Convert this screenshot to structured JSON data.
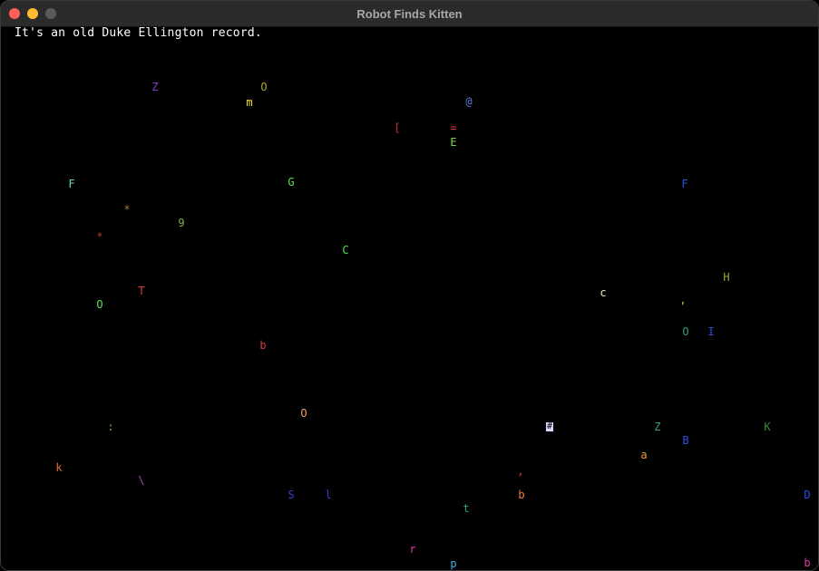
{
  "window": {
    "title": "Robot Finds Kitten"
  },
  "game": {
    "message": "It's an old Duke Ellington record.",
    "robot": {
      "glyph": "#",
      "color": "#d8d8ff"
    },
    "objects": [
      {
        "glyph": "Z",
        "color": "#8a3fbf"
      },
      {
        "glyph": "O",
        "color": "#a8a23a"
      },
      {
        "glyph": "m",
        "color": "#f0e040"
      },
      {
        "glyph": "@",
        "color": "#5b7fd8"
      },
      {
        "glyph": "[",
        "color": "#c83030"
      },
      {
        "glyph": "=",
        "color": "#e03a3a"
      },
      {
        "glyph": "E",
        "color": "#7fd84a"
      },
      {
        "glyph": "F",
        "color": "#5ce0a0"
      },
      {
        "glyph": "G",
        "color": "#5ce05c"
      },
      {
        "glyph": "F",
        "color": "#2f4fe8"
      },
      {
        "glyph": "*",
        "color": "#b07a3a"
      },
      {
        "glyph": "9",
        "color": "#7fb84a"
      },
      {
        "glyph": "*",
        "color": "#b03a2a"
      },
      {
        "glyph": "C",
        "color": "#5ce05c"
      },
      {
        "glyph": "H",
        "color": "#a8a23a"
      },
      {
        "glyph": "T",
        "color": "#e03a3a"
      },
      {
        "glyph": "c",
        "color": "#e8e8c8"
      },
      {
        "glyph": ",",
        "color": "#c8a860"
      },
      {
        "glyph": "O",
        "color": "#5ce05c"
      },
      {
        "glyph": "O",
        "color": "#2fa07a"
      },
      {
        "glyph": "I",
        "color": "#2f4fe8"
      },
      {
        "glyph": "b",
        "color": "#d83a3a"
      },
      {
        "glyph": "O",
        "color": "#f0a070"
      },
      {
        "glyph": ":",
        "color": "#a8a23a"
      },
      {
        "glyph": "Z",
        "color": "#2fa07a"
      },
      {
        "glyph": "K",
        "color": "#3a8a3a"
      },
      {
        "glyph": "B",
        "color": "#2f4fe8"
      },
      {
        "glyph": "a",
        "color": "#f0a030"
      },
      {
        "glyph": "k",
        "color": "#e06a3a"
      },
      {
        "glyph": "\\",
        "color": "#b03abf"
      },
      {
        "glyph": ",",
        "color": "#e03a3a"
      },
      {
        "glyph": "S",
        "color": "#3a3ad8"
      },
      {
        "glyph": "l",
        "color": "#3a3ad8"
      },
      {
        "glyph": "b",
        "color": "#f07a3a"
      },
      {
        "glyph": "t",
        "color": "#2fa07a"
      },
      {
        "glyph": "D",
        "color": "#2f4fe8"
      },
      {
        "glyph": "r",
        "color": "#e03aa0"
      },
      {
        "glyph": "p",
        "color": "#3ab8e8"
      },
      {
        "glyph": "b",
        "color": "#e03aa0"
      }
    ]
  }
}
